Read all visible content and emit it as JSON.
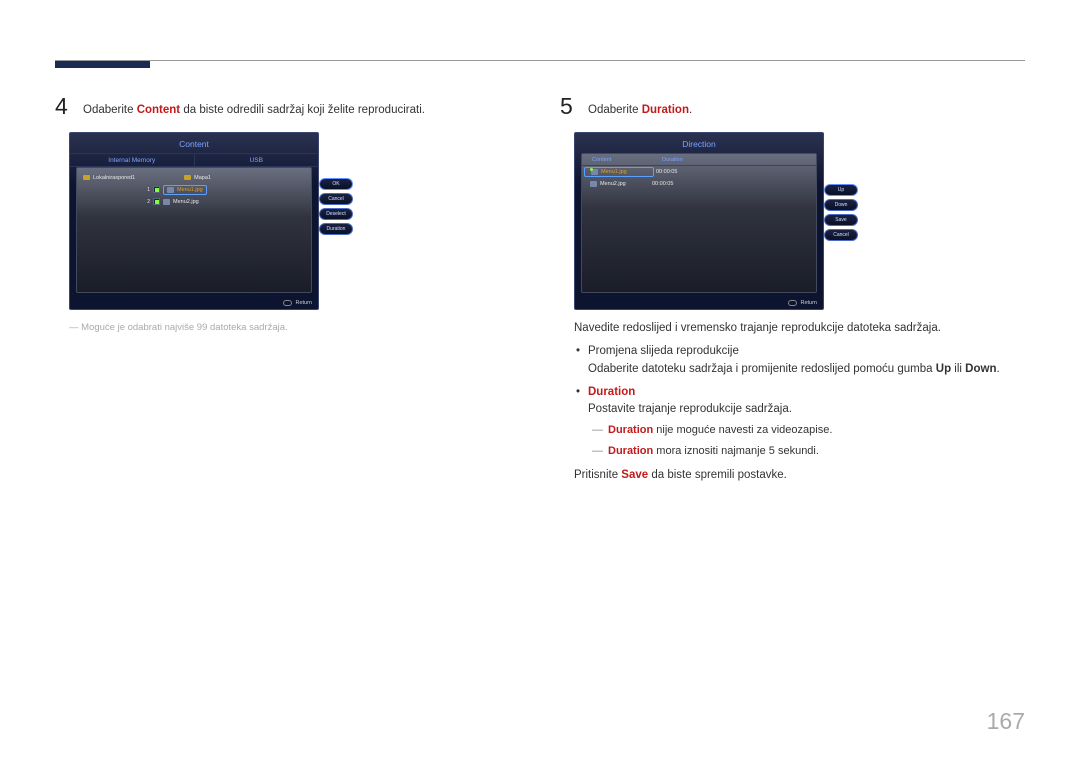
{
  "page_number": "167",
  "left": {
    "step_num": "4",
    "step_text_pre": "Odaberite ",
    "step_text_bold": "Content",
    "step_text_post": " da biste odredili sadržaj koji želite reproducirati.",
    "panel": {
      "title": "Content",
      "tab1": "Internal Memory",
      "tab2": "USB",
      "left_item": "Lokalniraspored1",
      "right_folder": "Mapa1",
      "file1_num": "1",
      "file1": "Menu1.jpg",
      "file2_num": "2",
      "file2": "Menu2.jpg",
      "buttons": [
        "OK",
        "Cancel",
        "Deselect",
        "Duration"
      ],
      "return": "Return"
    },
    "note": "Moguće je odabrati najviše 99 datoteka sadržaja."
  },
  "right": {
    "step_num": "5",
    "step_text_pre": "Odaberite ",
    "step_text_bold": "Duration",
    "step_text_post": ".",
    "panel": {
      "title": "Direction",
      "col1": "Content",
      "col2": "Duration",
      "row1_file": "Menu1.jpg",
      "row1_dur": "00:00:05",
      "row2_file": "Menu2.jpg",
      "row2_dur": "00:00:05",
      "buttons": [
        "Up",
        "Down",
        "Save",
        "Cancel"
      ],
      "return": "Return"
    },
    "body1": "Navedite redoslijed i vremensko trajanje reprodukcije datoteka sadržaja.",
    "bullet1_title": "Promjena slijeda reprodukcije",
    "bullet1_body_pre": "Odaberite datoteku sadržaja i promijenite redoslijed pomoću gumba ",
    "bullet1_up": "Up",
    "bullet1_mid": " ili ",
    "bullet1_down": "Down",
    "bullet1_post": ".",
    "bullet2_title": "Duration",
    "bullet2_body": "Postavite trajanje reprodukcije sadržaja.",
    "bullet2_note1_bold": "Duration",
    "bullet2_note1_post": " nije moguće navesti za videozapise.",
    "bullet2_note2_bold": "Duration",
    "bullet2_note2_post": " mora iznositi najmanje 5 sekundi.",
    "body2_pre": "Pritisnite ",
    "body2_bold": "Save",
    "body2_post": " da biste spremili postavke."
  }
}
